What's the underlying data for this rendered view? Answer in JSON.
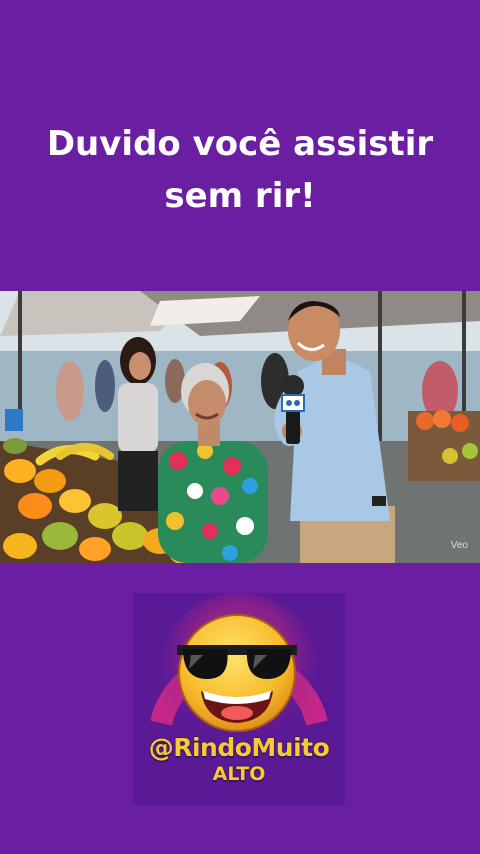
{
  "headline": {
    "line1": "Duvido você assistir",
    "line2": "sem rir!"
  },
  "video": {
    "scene": "market-interview",
    "watermark": "Veo"
  },
  "logo": {
    "icon": "sunglasses-laughing-emoji-icon",
    "handle": "@RindoMuito",
    "subtitle": "ALTO",
    "colors": {
      "text": "#f7c934",
      "outline": "#3a1462",
      "glow": "#e2368c",
      "card": "#5a1a96"
    }
  },
  "colors": {
    "background": "#6a1fa3",
    "headline_text": "#ffffff"
  }
}
